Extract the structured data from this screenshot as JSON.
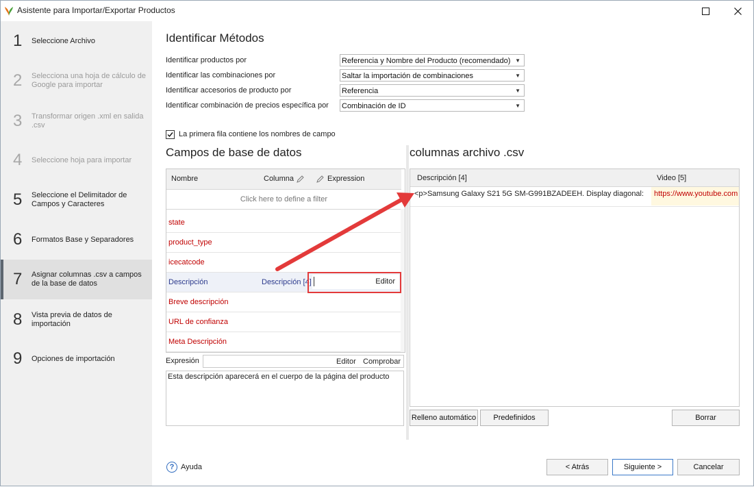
{
  "window": {
    "title": "Asistente para Importar/Exportar Productos"
  },
  "sidebar": {
    "steps": [
      {
        "num": "1",
        "label": "Seleccione Archivo",
        "state": "enabled"
      },
      {
        "num": "2",
        "label": "Selecciona una hoja de cálculo de Google para importar",
        "state": "disabled"
      },
      {
        "num": "3",
        "label": "Transformar origen .xml en salida .csv",
        "state": "disabled"
      },
      {
        "num": "4",
        "label": "Seleccione hoja para importar",
        "state": "disabled"
      },
      {
        "num": "5",
        "label": "Seleccione el Delimitador de Campos y Caracteres",
        "state": "enabled"
      },
      {
        "num": "6",
        "label": "Formatos Base y Separadores",
        "state": "enabled"
      },
      {
        "num": "7",
        "label": "Asignar columnas .csv a campos de la base de datos",
        "state": "active"
      },
      {
        "num": "8",
        "label": "Vista previa de datos de importación",
        "state": "enabled"
      },
      {
        "num": "9",
        "label": "Opciones de importación",
        "state": "enabled"
      }
    ]
  },
  "identify": {
    "title": "Identificar Métodos",
    "rows": [
      {
        "label": "Identificar productos por",
        "value": "Referencia y Nombre del Producto (recomendado)"
      },
      {
        "label": "Identificar las combinaciones por",
        "value": "Saltar la importación de combinaciones"
      },
      {
        "label": "Identificar accesorios de producto por",
        "value": "Referencia"
      },
      {
        "label": "Identificar combinación de precios específica por",
        "value": "Combinación de ID"
      }
    ],
    "first_row_checkbox": {
      "label": "La primera fila contiene los nombres de campo",
      "checked": true
    }
  },
  "db_fields": {
    "title": "Campos de base de datos",
    "headers": {
      "name": "Nombre",
      "column": "Columna",
      "expression": "Expression"
    },
    "filter_text": "Click here to define a filter",
    "rows": [
      {
        "name": "state",
        "column": ""
      },
      {
        "name": "product_type",
        "column": ""
      },
      {
        "name": "icecatcode",
        "column": ""
      },
      {
        "name": "Descripción",
        "column": "Descripción [4]",
        "selected": true,
        "editor": "Editor"
      },
      {
        "name": "Breve descripción",
        "column": ""
      },
      {
        "name": "URL de confianza",
        "column": ""
      },
      {
        "name": "Meta Descripción",
        "column": ""
      }
    ],
    "expression": {
      "label": "Expresión",
      "editor_btn": "Editor",
      "check_btn": "Comprobar"
    },
    "description_text": "Esta descripción aparecerá en el cuerpo de la página del producto"
  },
  "csv_columns": {
    "title": "columnas archivo .csv",
    "headers": [
      "Descripción [4]",
      "Video [5]"
    ],
    "row": [
      "<p>Samsung Galaxy S21 5G SM-G991BZADEEH. Display diagonal:",
      "https://www.youtube.com"
    ],
    "buttons": {
      "autofill": "Relleno automático",
      "presets": "Predefinidos",
      "delete": "Borrar"
    }
  },
  "footer": {
    "help": "Ayuda",
    "back": "< Atrás",
    "next": "Siguiente >",
    "cancel": "Cancelar"
  },
  "colors": {
    "unmapped_field": "#c00000",
    "mapped_field": "#2c3a8c",
    "annotation": "#e33a3a"
  }
}
